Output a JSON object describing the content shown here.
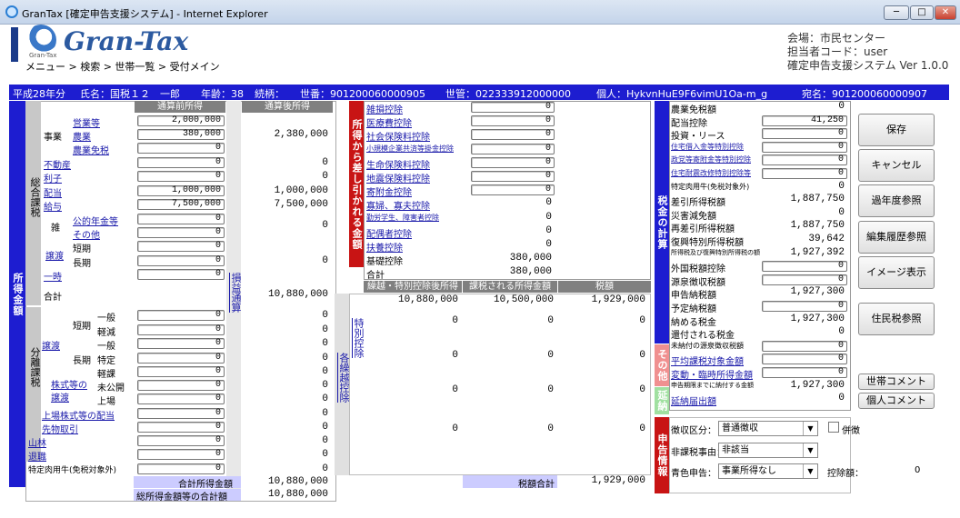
{
  "window": {
    "title": "GranTax [確定申告支援システム] - Internet Explorer",
    "btn_min": "─",
    "btn_max": "□",
    "btn_close": "✕"
  },
  "header": {
    "logo": "Gran-Tax",
    "logo_sub": "Gran-Tax",
    "breadcrumb": "メニュー > 検索 > 世帯一覧 > 受付メイン",
    "venue": "会場：市民センター",
    "user": "担当者コード：user",
    "version": "確定申告支援システム Ver 1.0.0"
  },
  "infobar": {
    "year": "平成28年分",
    "name": "氏名：国税１２　一郎",
    "age": "年齢：38",
    "relation": "続柄：",
    "household_no": "世番：901200060000905",
    "household_mgmt": "世管：022333912000000",
    "personal": "個人：HykvnHuE9F6vimU1Oa-m_g",
    "address_no": "宛名：901200060000907"
  },
  "income": {
    "section_label": "所得金額",
    "total_label": "総合課税",
    "separate_label": "分離課税",
    "header_before": "通算前所得",
    "header_after": "通算後所得",
    "business": "事業",
    "eigyo": "営業等",
    "eigyo_v": "2,000,000",
    "nogyo": "農業",
    "nogyo_v": "380,000",
    "nogyo_exempt": "農業免税",
    "nogyo_exempt_v": "0",
    "business_after": "2,380,000",
    "fudosan": "不動産",
    "fudosan_v": "0",
    "fudosan_after": "0",
    "rishi": "利子",
    "rishi_v": "0",
    "rishi_after": "0",
    "haito": "配当",
    "haito_v": "1,000,000",
    "haito_after": "1,000,000",
    "kyuyo": "給与",
    "kyuyo_v": "7,500,000",
    "kyuyo_after": "7,500,000",
    "zatsu": "雑",
    "koteki": "公的年金等",
    "koteki_v": "0",
    "sonota": "その他",
    "sonota_v": "0",
    "zatsu_after": "0",
    "joto": "譲渡",
    "tanki": "短期",
    "tanki_v": "0",
    "choki": "長期",
    "choki_v": "0",
    "joto_after": "0",
    "ichiji": "一時",
    "ichiji_v": "0",
    "gokei": "合計",
    "gokei_after": "10,880,000",
    "sep_joto": "譲渡",
    "sep_tanki": "短期",
    "sep_choki": "長期",
    "ippan": "一般",
    "keigen": "軽減",
    "tokutei": "特定",
    "keika": "軽課",
    "sep_values": [
      "0",
      "0",
      "0",
      "0",
      "0"
    ],
    "kabushiki": "株式等の譲渡",
    "mikokai": "未公開",
    "jojo": "上場",
    "kab_values": [
      "0",
      "0"
    ],
    "jojo_haito": "上場株式等の配当",
    "jojo_haito_v": "0",
    "sakimono": "先物取引",
    "sakimono_v": "0",
    "sanrin": "山林",
    "sanrin_v": "0",
    "taishoku": "退職",
    "taishoku_v": "0",
    "tokutei_ushi": "特定肉用牛(免税対象外)",
    "tokutei_ushi_v": "0",
    "after_zeros": [
      "0",
      "0",
      "0",
      "0",
      "0",
      "0",
      "0",
      "0",
      "0",
      "0",
      "0",
      "0",
      "0"
    ],
    "sum_label": "合計所得金額",
    "sum_value": "10,880,000",
    "total_sum_label": "総所得金額等の合計額",
    "total_sum_value": "10,880,000",
    "vertical_sontsu": "損益通算",
    "vertical_kurikoshi": "各繰越控除"
  },
  "deduction": {
    "title": "所得から差し引かれる金額",
    "items": [
      {
        "label": "雑損控除",
        "v": "0",
        "input": true
      },
      {
        "label": "医療費控除",
        "v": "0",
        "input": true
      },
      {
        "label": "社会保険料控除",
        "v": "0",
        "input": true
      },
      {
        "label": "小規模企業共済等掛金控除",
        "v": "0",
        "input": true
      },
      {
        "label": "生命保険料控除",
        "v": "0",
        "input": true
      },
      {
        "label": "地震保険料控除",
        "v": "0",
        "input": true
      },
      {
        "label": "寄附金控除",
        "v": "0",
        "input": true
      },
      {
        "label": "寡婦、寡夫控除",
        "v": "0",
        "input": false
      },
      {
        "label": "勤労学生、障害者控除",
        "v": "0",
        "input": false
      },
      {
        "label": "配偶者控除",
        "v": "0",
        "input": false
      },
      {
        "label": "扶養控除",
        "v": "0",
        "input": false
      },
      {
        "label": "基礎控除",
        "v": "380,000",
        "input": false
      },
      {
        "label": "合計",
        "v": "380,000",
        "input": false
      }
    ]
  },
  "carry": {
    "h1": "繰越・特別控除後所得",
    "h2": "課税される所得金額",
    "h3": "税額",
    "r1": "10,880,000",
    "r2": "10,500,000",
    "r3": "1,929,000",
    "special": "特別控除",
    "zeros": [
      "0",
      "0",
      "0",
      "0",
      "0",
      "0",
      "0",
      "0",
      "0",
      "0",
      "0",
      "0"
    ],
    "tax_sum_label": "税額合計",
    "tax_sum_value": "1,929,000"
  },
  "tax": {
    "title": "税金の計算",
    "other": "その他",
    "extension": "延納",
    "declare": "申告情報",
    "items": [
      {
        "label": "農業免税額",
        "v": "0",
        "input": false
      },
      {
        "label": "配当控除",
        "v": "41,250",
        "input": true
      },
      {
        "label": "投資・リース",
        "v": "0",
        "input": true
      },
      {
        "label": "住宅借入金等特別控除",
        "v": "0",
        "input": true
      },
      {
        "label": "政党等寄附金等特別控除",
        "v": "0",
        "input": true
      },
      {
        "label": "住宅耐震改修特別控除等",
        "v": "0",
        "input": true
      },
      {
        "label": "特定肉用牛(免税対象外)",
        "v": "0",
        "input": false
      },
      {
        "label": "差引所得税額",
        "v": "1,887,750",
        "input": false
      },
      {
        "label": "災害減免額",
        "v": "0",
        "input": false
      },
      {
        "label": "再差引所得税額",
        "v": "1,887,750",
        "input": false
      },
      {
        "label": "復興特別所得税額",
        "v": "39,642",
        "input": false
      },
      {
        "label": "所得税及び復興特別所得税の額",
        "v": "1,927,392",
        "input": false
      },
      {
        "label": "外国税額控除",
        "v": "0",
        "input": true
      },
      {
        "label": "源泉徴収税額",
        "v": "0",
        "input": true
      },
      {
        "label": "申告納税額",
        "v": "1,927,300",
        "input": false
      },
      {
        "label": "予定納税額",
        "v": "0",
        "input": true
      },
      {
        "label": "納める税金",
        "v": "1,927,300",
        "input": false
      },
      {
        "label": "還付される税金",
        "v": "0",
        "input": false
      }
    ],
    "other_items": [
      {
        "label": "未納付の源泉徴収税額",
        "v": "0"
      },
      {
        "label": "平均課税対象金額",
        "v": "0"
      },
      {
        "label": "変動・臨時所得金額",
        "v": "0"
      }
    ],
    "ext_items": [
      {
        "label": "申告期限までに納付する金額",
        "v": "1,927,300"
      },
      {
        "label": "延納届出額",
        "v": "0"
      }
    ],
    "kubun_label": "徴収区分：",
    "kubun_value": "普通徴収",
    "heichou": "併徴",
    "hikazei_label": "非課税事由：",
    "hikazei_value": "非該当",
    "aoiro_label": "青色申告：",
    "aoiro_value": "事業所得なし",
    "kojo_label": "控除額：",
    "kojo_value": "0"
  },
  "buttons": {
    "save": "保存",
    "cancel": "キャンセル",
    "prev_year": "過年度参照",
    "history": "編集履歴参照",
    "image": "イメージ表示",
    "resident": "住民税参照",
    "household_comment": "世帯コメント",
    "personal_comment": "個人コメント"
  },
  "colors": {
    "blue": "#1d1dd0",
    "red": "#c81414",
    "green": "#28a028",
    "purple_cell": "#ccccff",
    "gray": "#808080"
  }
}
